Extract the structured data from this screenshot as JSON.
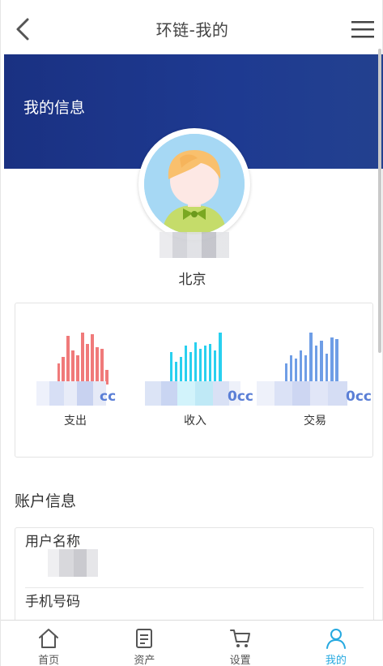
{
  "header": {
    "title": "环链-我的",
    "back_icon": "chevron-left-icon",
    "menu_icon": "hamburger-menu-icon"
  },
  "banner": {
    "title": "我的信息",
    "color": "#1e3a91"
  },
  "profile": {
    "city": "北京"
  },
  "stats": [
    {
      "label": "支出",
      "suffix": "cc",
      "color": "#f07a7a",
      "icon": "bar-chart-icon"
    },
    {
      "label": "收入",
      "suffix": "0cc",
      "color": "#29d0ef",
      "icon": "bar-chart-icon"
    },
    {
      "label": "交易",
      "suffix": "0cc",
      "color": "#6f9ee6",
      "icon": "bar-chart-icon"
    }
  ],
  "account": {
    "section_title": "账户信息",
    "fields": [
      {
        "label": "用户名称"
      },
      {
        "label": "手机号码"
      }
    ]
  },
  "tabbar": {
    "active_color": "#26a9e0",
    "items": [
      {
        "label": "首页",
        "icon": "home-icon"
      },
      {
        "label": "资产",
        "icon": "document-icon"
      },
      {
        "label": "设置",
        "icon": "cart-icon"
      },
      {
        "label": "我的",
        "icon": "user-icon"
      }
    ]
  }
}
